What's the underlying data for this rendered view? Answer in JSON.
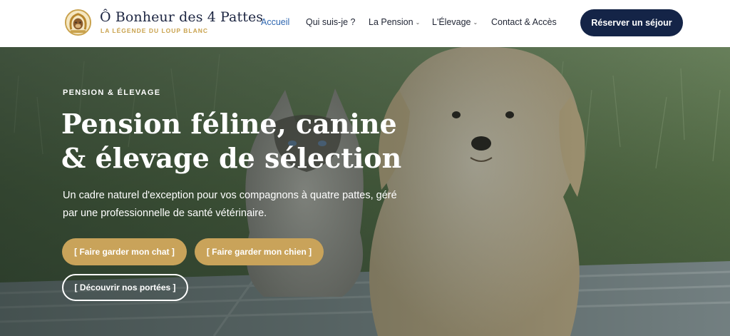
{
  "brand": {
    "name": "Ô Bonheur des 4 Pattes",
    "tagline": "LA LÉGENDE DU LOUP BLANC",
    "logo_icon": "horseshoe-dog-badge-icon"
  },
  "nav": {
    "items": [
      {
        "label": "Accueil",
        "active": true,
        "has_dropdown": false
      },
      {
        "label": "Qui suis-je ?",
        "active": false,
        "has_dropdown": false
      },
      {
        "label": "La Pension",
        "active": false,
        "has_dropdown": true
      },
      {
        "label": "L'Élevage",
        "active": false,
        "has_dropdown": true
      },
      {
        "label": "Contact & Accès",
        "active": false,
        "has_dropdown": false
      }
    ],
    "dropdown_glyph": "⌄",
    "cta_label": "Réserver un séjour"
  },
  "hero": {
    "eyebrow": "PENSION & ÉLEVAGE",
    "title": "Pension féline, canine & élevage de sélection",
    "description": "Un cadre naturel d'exception pour vos compagnons à quatre pattes, géré par une professionnelle de santé vétérinaire.",
    "buttons": {
      "cat": "[ Faire garder mon chat ]",
      "dog": "[ Faire garder mon chien ]",
      "litters": "[ Découvrir nos portées ]"
    },
    "background": "photo of a cat and a golden retriever on a blanket in grass"
  },
  "colors": {
    "navy": "#142447",
    "gold": "#c9a35a",
    "active_link": "#2e66b0"
  }
}
